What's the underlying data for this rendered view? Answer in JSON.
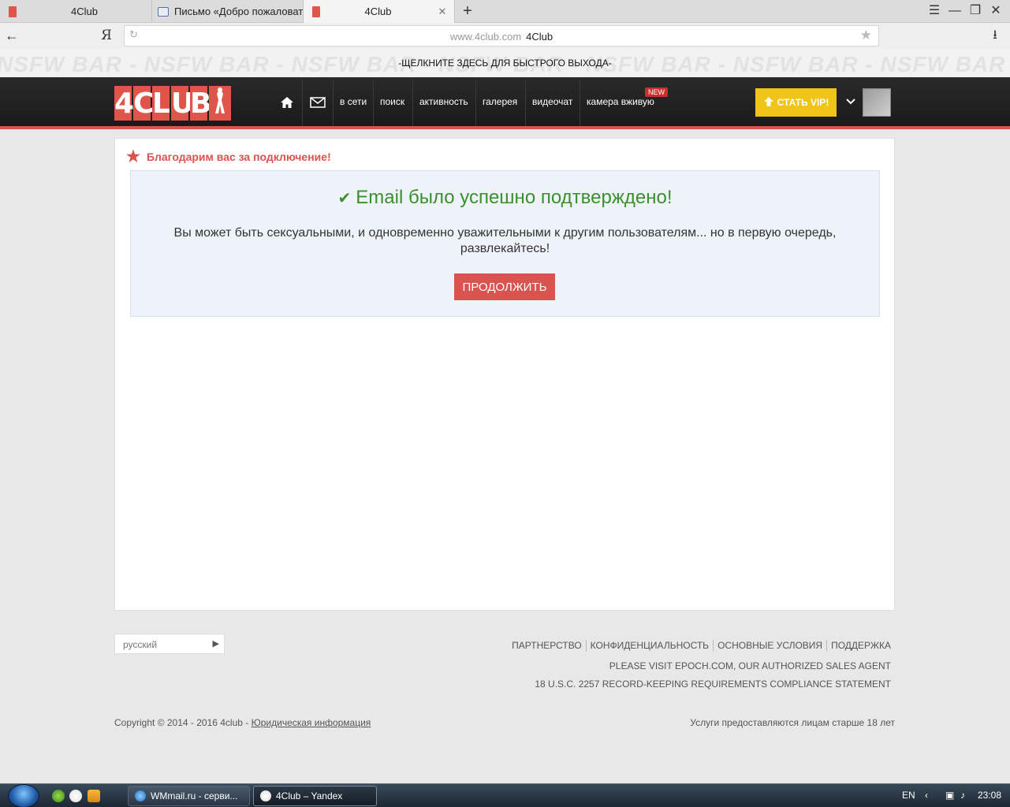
{
  "browser": {
    "tabs": [
      {
        "label": "4Club",
        "favicon": "4club-icon"
      },
      {
        "label": "Письмо «Добро пожаловать",
        "favicon": "mail-icon"
      },
      {
        "label": "4Club",
        "favicon": "4club-icon",
        "close": "✕"
      }
    ],
    "new_tab": "+",
    "yandex_button": "Я",
    "address": {
      "domain": "www.4club.com",
      "title": "4Club"
    }
  },
  "nsfw_bar": {
    "pattern": "NSFW BAR - NSFW BAR - NSFW BAR - NSFW BAR - NSFW BAR - NSFW BAR - NSFW BAR - NSFW BAR - NSFW BAR - NSFW BAR - NSFW BAR",
    "exit_text": "-ЩЕЛКНИТЕ ЗДЕСЬ ДЛЯ БЫСТРОГО ВЫХОДА-"
  },
  "header": {
    "logo": [
      "4",
      "C",
      "L",
      "U",
      "B"
    ],
    "nav": {
      "online": "в сети",
      "search": "поиск",
      "activity": "активность",
      "gallery": "галерея",
      "videochat": "видеочат",
      "live_cam": "камера вживую"
    },
    "new_badge": "NEW",
    "vip_button": "СТАТЬ VIP!",
    "accent_color": "#d9534f",
    "vip_color": "#f0c419"
  },
  "main": {
    "thanks_heading": "Благодарим вас за подключение!",
    "confirm_title": "Email было успешно подтверждено!",
    "confirm_message": "Вы может быть сексуальными, и одновременно уважительными к другим пользователям... но в первую очередь, развлекайтесь!",
    "continue_button": "ПРОДОЛЖИТЬ",
    "success_color": "#3c8f2f"
  },
  "footer": {
    "language": "русский",
    "links": {
      "partnership": "ПАРТНЕРСТВО",
      "privacy": "КОНФИДЕНЦИАЛЬНОСТЬ",
      "terms": "ОСНОВНЫЕ УСЛОВИЯ",
      "support": "ПОДДЕРЖКА"
    },
    "epoch_line": "PLEASE VISIT EPOCH.COM, OUR AUTHORIZED SALES AGENT",
    "compliance_line": "18 U.S.C. 2257 RECORD-KEEPING REQUIREMENTS COMPLIANCE STATEMENT",
    "copyright": "Copyright © 2014 - 2016 4club - ",
    "legal_link": "Юридическая информация",
    "age_note": "Услуги предоставляются лицам старше 18 лет"
  },
  "taskbar": {
    "items": [
      {
        "label": "WMmail.ru - серви...",
        "icon": "ie-icon"
      },
      {
        "label": "4Club – Yandex",
        "icon": "yandex-browser-icon"
      }
    ],
    "lang": "EN",
    "time": "23:08"
  }
}
